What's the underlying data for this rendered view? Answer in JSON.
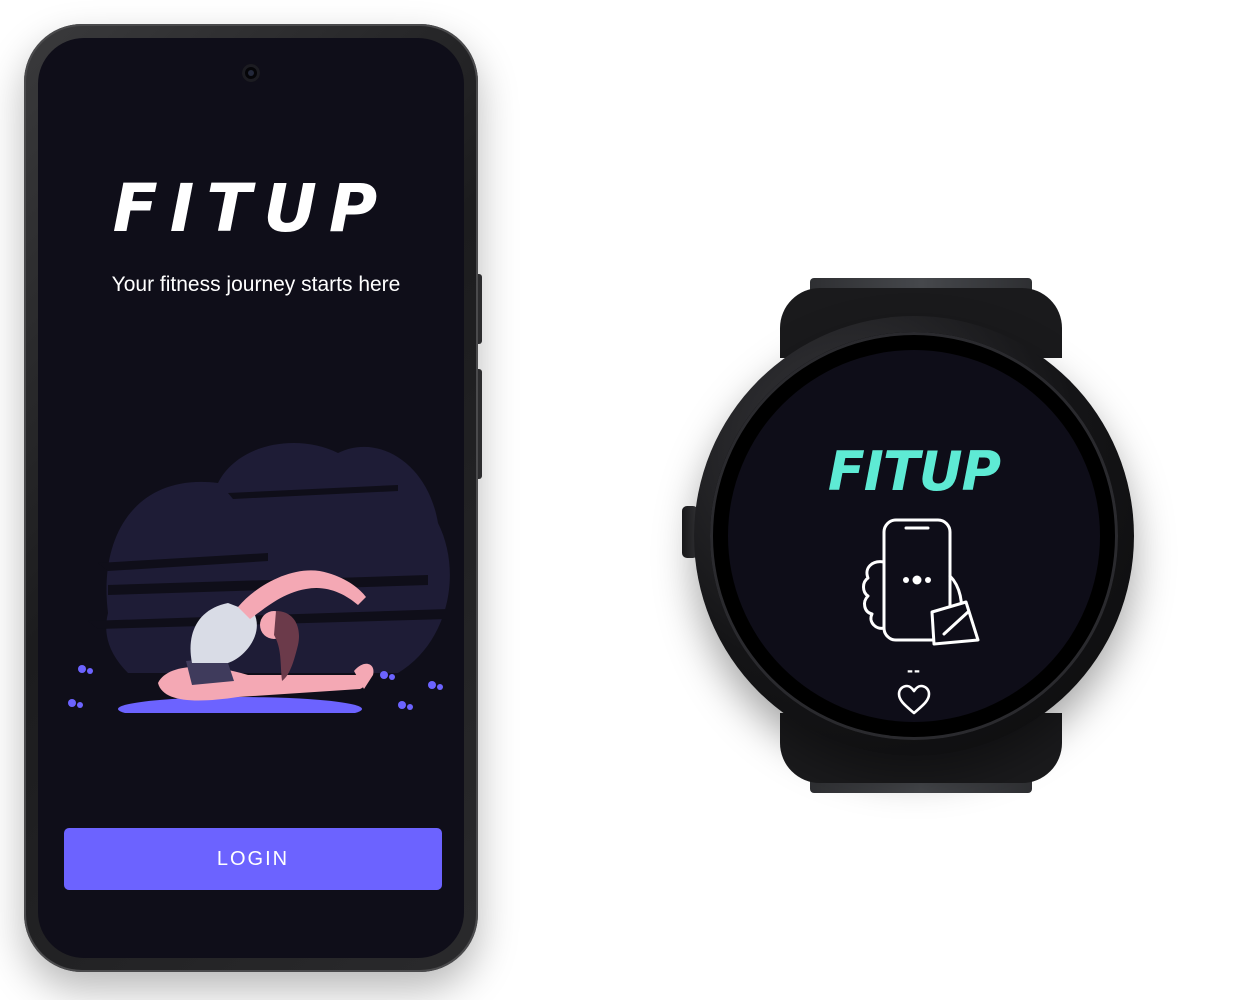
{
  "phone_app": {
    "logo": "FITUP",
    "tagline": "Your fitness journey starts here",
    "login_button": "LOGIN"
  },
  "watch_app": {
    "logo": "FITUP",
    "heart_rate": "--",
    "icons": [
      "phone-in-hand-icon",
      "heart-icon"
    ],
    "accent_color": "#5eead4"
  },
  "colors": {
    "background": "#0f0e19",
    "button": "#6c63ff"
  }
}
